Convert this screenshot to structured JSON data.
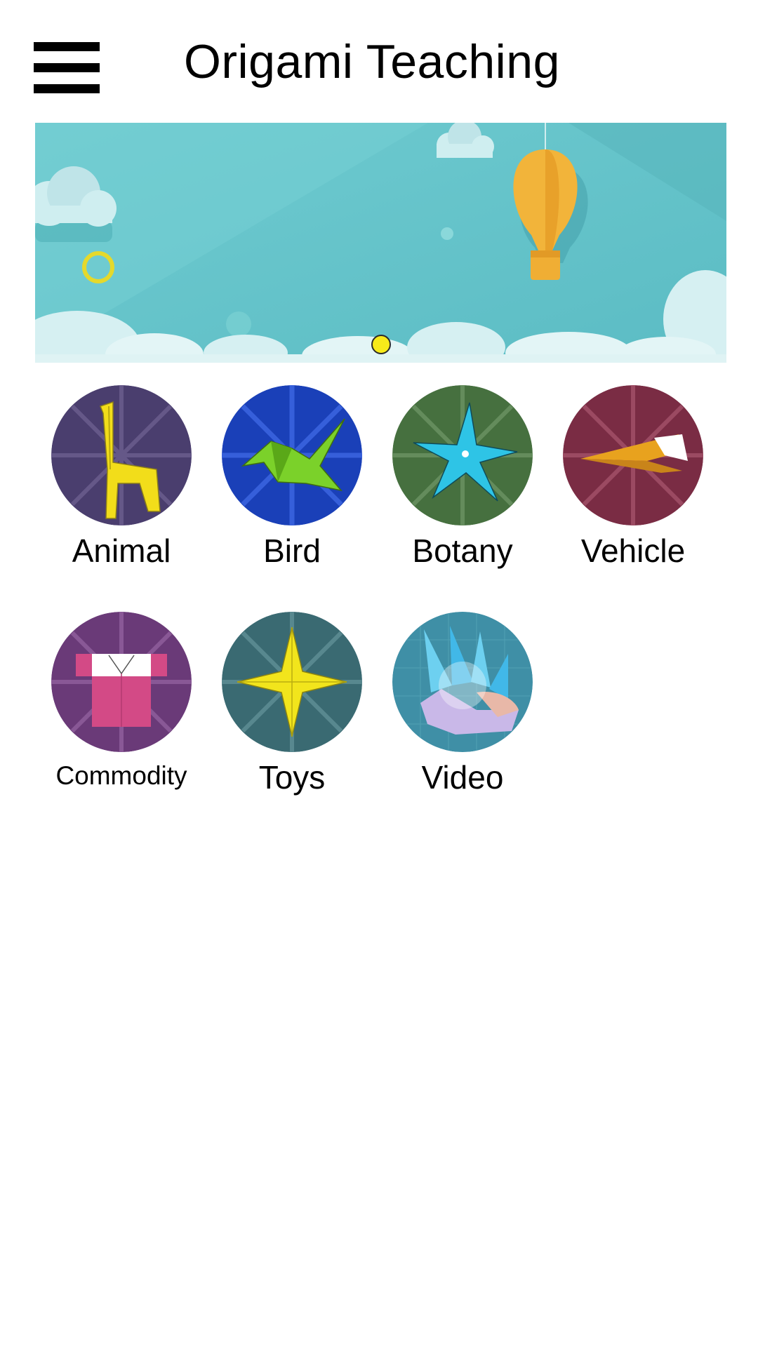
{
  "header": {
    "title": "Origami Teaching",
    "menu_icon": "hamburger-menu-icon"
  },
  "banner": {
    "theme": "sky-with-hot-air-balloon",
    "sky_color": "#64c3c9",
    "balloon_color": "#f2b43a",
    "indicator_color": "#f7ea1a",
    "slide_index": 1
  },
  "categories": [
    {
      "label": "Animal",
      "icon": "giraffe-origami-icon",
      "bg": "#4a3e6e",
      "fg": "#f2dd1a"
    },
    {
      "label": "Bird",
      "icon": "crane-origami-icon",
      "bg": "#1a40b8",
      "fg": "#7bd12a"
    },
    {
      "label": "Botany",
      "icon": "star-flower-origami-icon",
      "bg": "#46703f",
      "fg": "#2ec4e6"
    },
    {
      "label": "Vehicle",
      "icon": "paper-plane-origami-icon",
      "bg": "#7a2c44",
      "fg": "#e8a21e"
    },
    {
      "label": "Commodity",
      "icon": "shirt-origami-icon",
      "bg": "#6a3a78",
      "fg": "#d34a86"
    },
    {
      "label": "Toys",
      "icon": "ninja-star-origami-icon",
      "bg": "#3a6a72",
      "fg": "#f2e51c"
    },
    {
      "label": "Video",
      "icon": "origami-claws-video-icon",
      "bg": "#3f8fa6",
      "fg": "#41b8e8"
    }
  ]
}
